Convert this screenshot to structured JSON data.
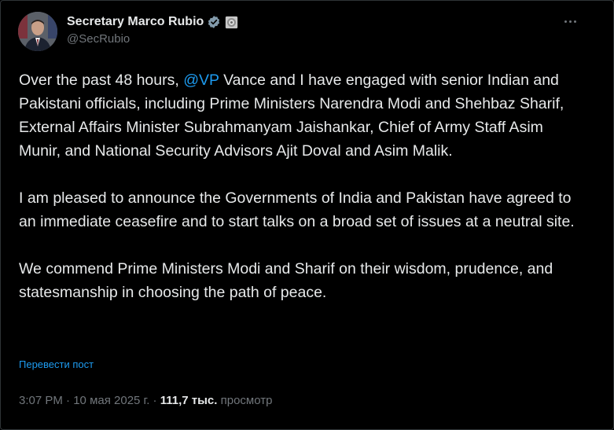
{
  "author": {
    "display_name": "Secretary Marco Rubio",
    "handle": "@SecRubio",
    "verified_badge": "verified-checkmark-icon",
    "affiliate_badge": "government-seal-icon",
    "avatar": "avatar-portrait"
  },
  "more_button": "more-options-icon",
  "tweet": {
    "p1_pre": "Over the past 48 hours, ",
    "p1_mention": "@VP",
    "p1_post": " Vance and I have engaged with senior Indian and Pakistani officials, including Prime Ministers Narendra Modi and Shehbaz Sharif, External Affairs Minister Subrahmanyam Jaishankar, Chief of Army Staff Asim Munir, and National Security Advisors Ajit Doval and Asim Malik.",
    "p2": "I am pleased to announce the Governments of India and Pakistan have agreed to an immediate ceasefire and to start talks on a broad set of issues at a neutral site.",
    "p3": "We commend Prime Ministers Modi and Sharif on their wisdom, prudence, and statesmanship in choosing the path of peace."
  },
  "translate_label": "Перевести пост",
  "meta": {
    "time": "3:07 PM",
    "separator": " · ",
    "date": "10 мая 2025 г.",
    "separator2": " · ",
    "views_count": "111,7 тыс.",
    "views_label": " просмотр"
  },
  "colors": {
    "background": "#000000",
    "text": "#e7e9ea",
    "muted": "#71767b",
    "accent": "#1d9bf0"
  }
}
